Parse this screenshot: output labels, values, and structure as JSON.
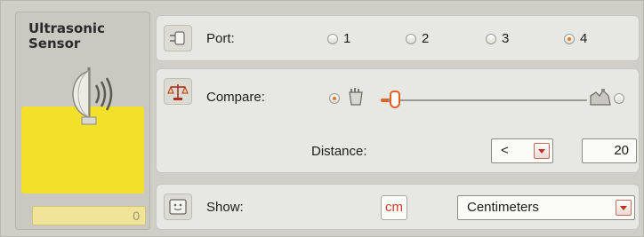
{
  "block": {
    "title_line1": "Ultrasonic",
    "title_line2": "Sensor",
    "value": "0"
  },
  "port": {
    "label": "Port:",
    "options": [
      "1",
      "2",
      "3",
      "4"
    ],
    "selected": "4"
  },
  "compare": {
    "label": "Compare:",
    "selected_side": "left",
    "slider_position": 0.05,
    "distance_label": "Distance:",
    "operator": "<",
    "value": "20"
  },
  "show": {
    "label": "Show:",
    "unit_button": "cm",
    "units": "Centimeters"
  },
  "colors": {
    "accent": "#e0602a",
    "yellow": "#f3e02a",
    "panel": "#e8e8e2"
  },
  "icons": {
    "sensor": "ultrasonic-sensor-icon",
    "port": "port-plug-icon",
    "compare": "scale-balance-icon",
    "show": "display-face-icon",
    "near": "near-object-icon",
    "far": "far-object-icon"
  }
}
